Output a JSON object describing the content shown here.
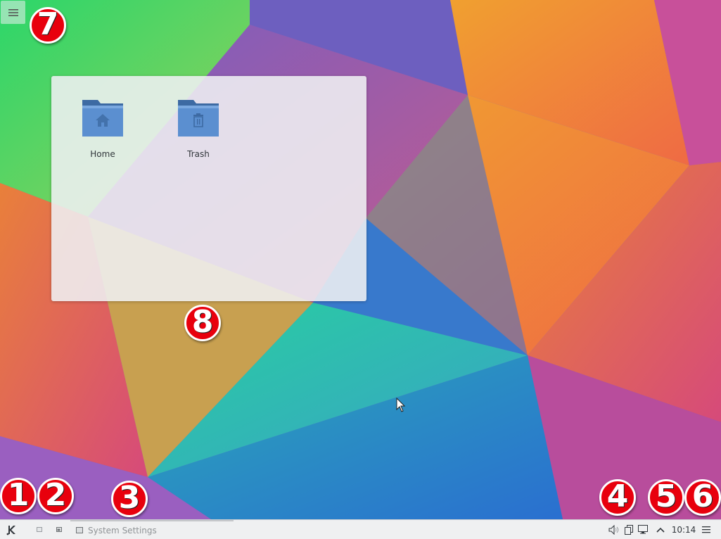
{
  "desktop": {
    "toolbox_icon": "menu-icon",
    "icons": [
      {
        "label": "Home",
        "icon": "home-folder-icon"
      },
      {
        "label": "Trash",
        "icon": "trash-folder-icon"
      }
    ]
  },
  "badges": [
    "1",
    "2",
    "3",
    "4",
    "5",
    "6",
    "7",
    "8"
  ],
  "panel": {
    "launcher_icon": "kde-launcher-icon",
    "pager": [
      "desktop-1",
      "desktop-2"
    ],
    "task": {
      "label": "System Settings",
      "icon": "system-settings-icon"
    },
    "tray": [
      "volume-icon",
      "clipboard-icon",
      "display-icon"
    ],
    "expand_icon": "chevron-up-icon",
    "clock": "10:14",
    "menu_icon": "hamburger-icon"
  },
  "colors": {
    "badge": "#e8000d",
    "panel": "#eff0f1",
    "folder": "#5b8fd0"
  }
}
